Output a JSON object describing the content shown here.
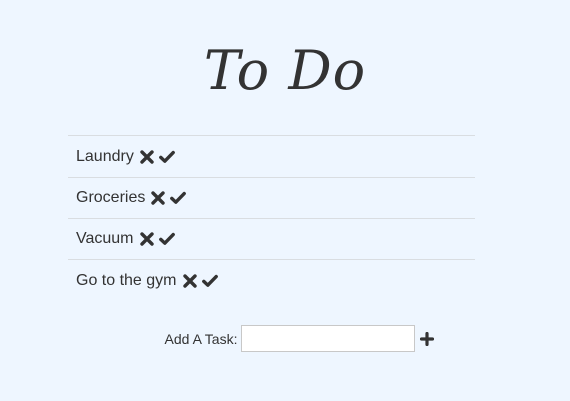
{
  "header": {
    "title": "To Do"
  },
  "tasks": [
    {
      "label": "Laundry",
      "delete_icon": "times-icon",
      "complete_icon": "check-icon"
    },
    {
      "label": "Groceries",
      "delete_icon": "times-icon",
      "complete_icon": "check-icon"
    },
    {
      "label": "Vacuum",
      "delete_icon": "times-icon",
      "complete_icon": "check-icon"
    },
    {
      "label": "Go to the gym",
      "delete_icon": "times-icon",
      "complete_icon": "check-icon"
    }
  ],
  "add_task": {
    "label": "Add A Task:",
    "value": "",
    "placeholder": "",
    "button_icon": "plus-icon"
  },
  "colors": {
    "background": "#eef6ff",
    "text": "#333333",
    "divider": "#d9dde1"
  }
}
